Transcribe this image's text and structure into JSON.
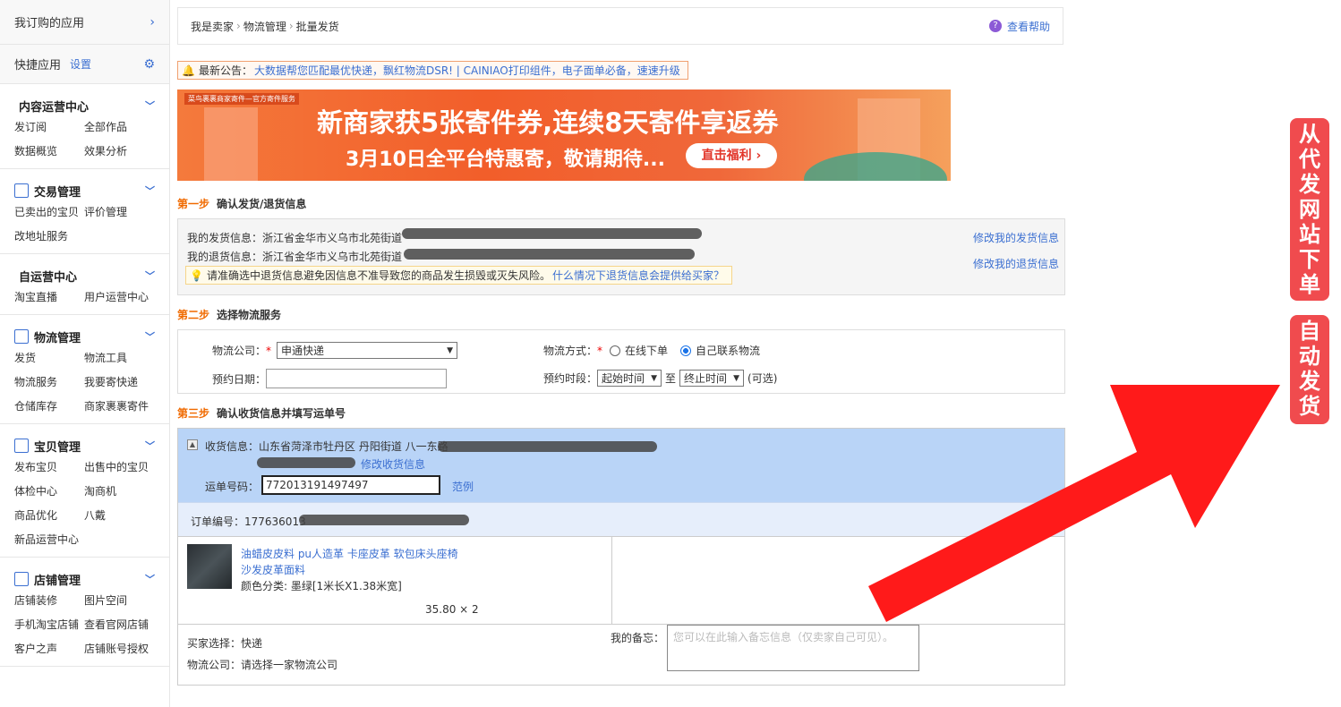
{
  "sidebar": {
    "subscribed_apps": "我订购的应用",
    "quick_apps": "快捷应用",
    "quick_settings": "设置",
    "sections": [
      {
        "title": "内容运营中心",
        "items": [
          "发订阅",
          "全部作品",
          "数据概览",
          "效果分析"
        ]
      },
      {
        "title": "交易管理",
        "items": [
          "已卖出的宝贝",
          "评价管理",
          "改地址服务"
        ]
      },
      {
        "title": "自运营中心",
        "items": [
          "淘宝直播",
          "用户运营中心"
        ]
      },
      {
        "title": "物流管理",
        "items": [
          "发货",
          "物流工具",
          "物流服务",
          "我要寄快递",
          "仓储库存",
          "商家裹裹寄件"
        ]
      },
      {
        "title": "宝贝管理",
        "items": [
          "发布宝贝",
          "出售中的宝贝",
          "体检中心",
          "淘商机",
          "商品优化",
          "八戴",
          "新品运营中心"
        ]
      },
      {
        "title": "店铺管理",
        "items": [
          "店铺装修",
          "图片空间",
          "手机淘宝店铺",
          "查看官网店铺",
          "客户之声",
          "店铺账号授权"
        ]
      }
    ]
  },
  "breadcrumb": {
    "items": [
      "我是卖家",
      "物流管理",
      "批量发货"
    ],
    "help": "查看帮助"
  },
  "notice": {
    "label": "最新公告：",
    "text": "大数据帮您匹配最优快递，飘红物流DSR! | CAINIAO打印组件，电子面单必备，速速升级"
  },
  "banner": {
    "tag": "菜鸟裹裹商家寄件—官方寄件服务",
    "line1": "新商家获5张寄件券,连续8天寄件享返券",
    "line2": "3月10日全平台特惠寄，敬请期待...",
    "button": "直击福利 ›"
  },
  "step1": {
    "num": "第一步",
    "title": "确认发货/退货信息",
    "ship_label": "我的发货信息：浙江省金华市义乌市北苑街道",
    "return_label": "我的退货信息：浙江省金华市义乌市北苑街道",
    "edit_ship": "修改我的发货信息",
    "edit_return": "修改我的退货信息",
    "warning": "请准确选中退货信息避免因信息不准导致您的商品发生损毁或灭失风险。",
    "warning_link": "什么情况下退货信息会提供给买家？"
  },
  "step2": {
    "num": "第二步",
    "title": "选择物流服务",
    "company_label": "物流公司：",
    "company_value": "申通快递",
    "method_label": "物流方式：",
    "method_online": "在线下单",
    "method_self": "自己联系物流",
    "date_label": "预约日期：",
    "period_label": "预约时段：",
    "start_time": "起始时间",
    "to": "至",
    "end_time": "终止时间",
    "optional": "(可选)"
  },
  "step3": {
    "num": "第三步",
    "title": "确认收货信息并填写运单号",
    "recv_label": "收货信息：山东省菏泽市牡丹区 丹阳街道 八一东路",
    "edit_recv": "修改收货信息",
    "waybill_label": "运单号码：",
    "waybill_value": "772013191497497",
    "example": "范例",
    "order_label": "订单编号：177636013",
    "item_title1": "油蜡皮皮料 pu人造革 卡座皮革   软包床头座椅",
    "item_title2": "沙发皮革面料",
    "item_color": "颜色分类: 墨绿[1米长X1.38米宽]",
    "item_price": "35.80 × 2",
    "buyer_choice": "买家选择：快递",
    "logistics_company": "物流公司：请选择一家物流公司",
    "memo_label": "我的备忘：",
    "memo_placeholder": "您可以在此输入备忘信息（仅卖家自己可见）。"
  },
  "overlay": {
    "badge1": "从代发网站下单",
    "badge2": "自动发货"
  },
  "colors": {
    "accent": "#3b6fd1",
    "step": "#f06a00",
    "badge": "#f04b4e",
    "arrow": "#ff1a1a"
  }
}
